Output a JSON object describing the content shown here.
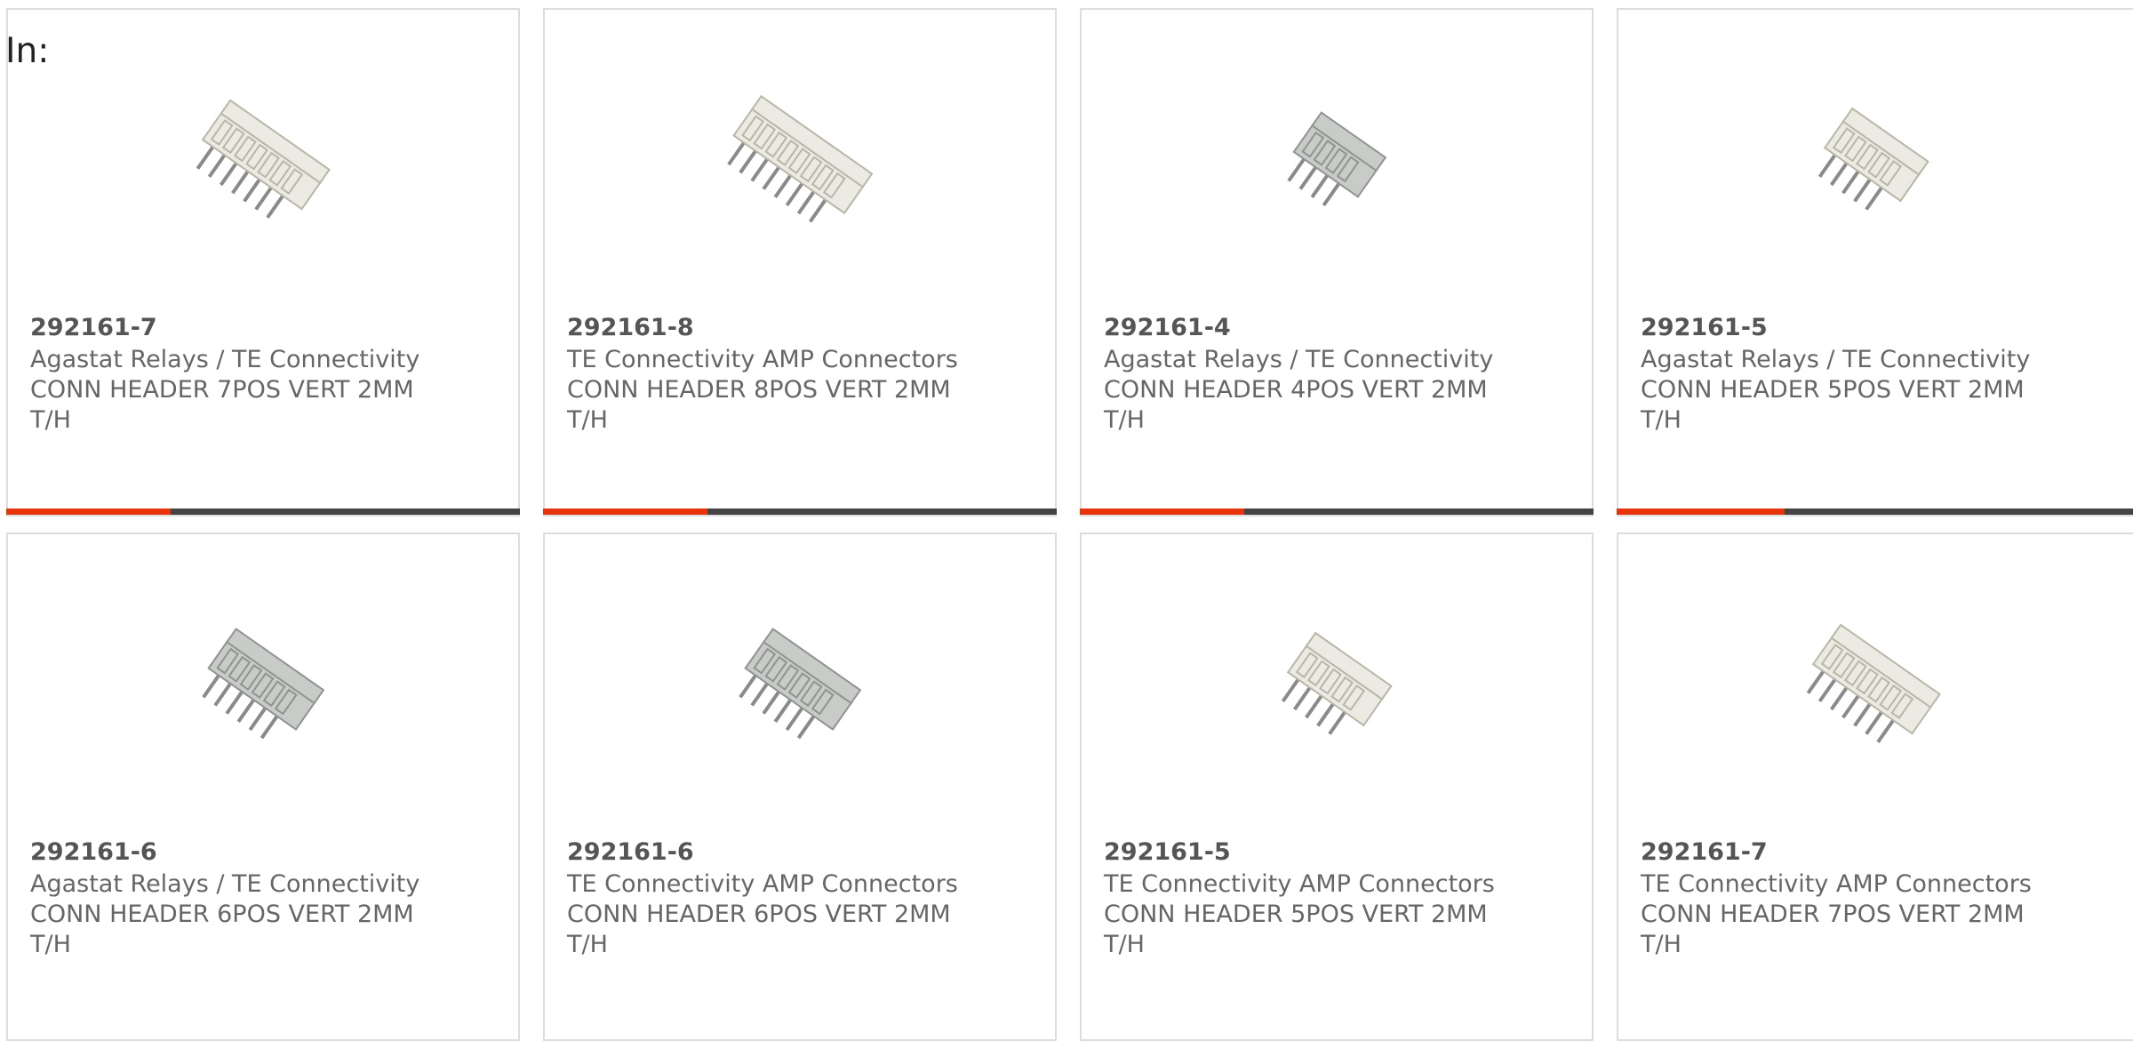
{
  "heading": "In:",
  "colors": {
    "accent": "#e8340c",
    "bar_track": "#444444",
    "card_border": "#dddddd",
    "text_primary": "#555555",
    "text_secondary": "#666666"
  },
  "cards": [
    {
      "part_number": "292161-7",
      "manufacturer": "Agastat Relays / TE Connectivity",
      "desc_line1": "CONN HEADER 7POS VERT 2MM",
      "desc_line2": "T/H",
      "icon": "connector-header-icon",
      "progress_fraction": 0.32
    },
    {
      "part_number": "292161-8",
      "manufacturer": "TE Connectivity AMP Connectors",
      "desc_line1": "CONN HEADER 8POS VERT 2MM",
      "desc_line2": "T/H",
      "icon": "connector-header-icon",
      "progress_fraction": 0.32
    },
    {
      "part_number": "292161-4",
      "manufacturer": "Agastat Relays / TE Connectivity",
      "desc_line1": "CONN HEADER 4POS VERT 2MM",
      "desc_line2": "T/H",
      "icon": "connector-header-icon",
      "progress_fraction": 0.32
    },
    {
      "part_number": "292161-5",
      "manufacturer": "Agastat Relays / TE Connectivity",
      "desc_line1": "CONN HEADER 5POS VERT 2MM",
      "desc_line2": "T/H",
      "icon": "connector-header-icon",
      "progress_fraction": 0.32
    },
    {
      "part_number": "292161-6",
      "manufacturer": "Agastat Relays / TE Connectivity",
      "desc_line1": "CONN HEADER 6POS VERT 2MM",
      "desc_line2": "T/H",
      "icon": "connector-header-icon"
    },
    {
      "part_number": "292161-6",
      "manufacturer": "TE Connectivity AMP Connectors",
      "desc_line1": "CONN HEADER 6POS VERT 2MM",
      "desc_line2": "T/H",
      "icon": "connector-header-icon"
    },
    {
      "part_number": "292161-5",
      "manufacturer": "TE Connectivity AMP Connectors",
      "desc_line1": "CONN HEADER 5POS VERT 2MM",
      "desc_line2": "T/H",
      "icon": "connector-header-icon"
    },
    {
      "part_number": "292161-7",
      "manufacturer": "TE Connectivity AMP Connectors",
      "desc_line1": "CONN HEADER 7POS VERT 2MM",
      "desc_line2": "T/H",
      "icon": "connector-header-icon"
    }
  ]
}
